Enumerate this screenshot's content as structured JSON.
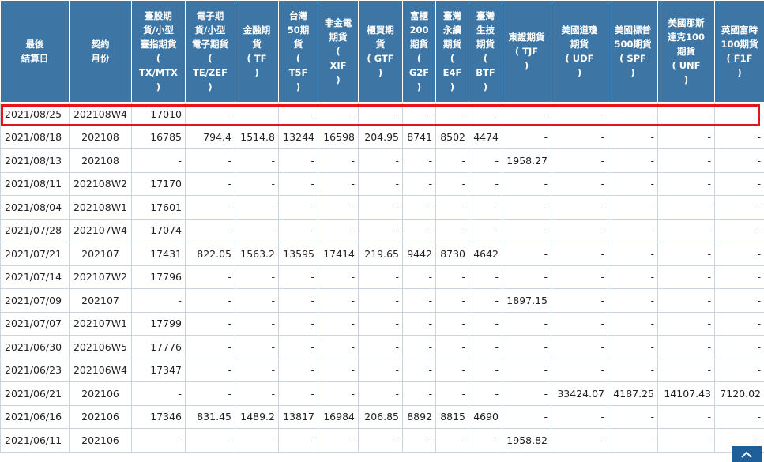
{
  "headers": [
    "最後\n結算日",
    "契約\n月份",
    "臺股期\n貨/小型\n臺指期貨\n(\nTX/MTX\n)",
    "電子期\n貨/小型\n電子期貨\n(\nTE/ZEF\n)",
    "金融期\n貨\n( TF\n)",
    "台灣\n50期\n貨\n(\nT5F\n)",
    "非金電\n期貨\n(\nXIF\n)",
    "櫃買期\n貨\n( GTF\n)",
    "富櫃\n200\n期貨\n(\nG2F\n)",
    "臺灣\n永續\n期貨\n(\nE4F\n)",
    "臺灣\n生技\n期貨\n(\nBTF\n)",
    "東證期貨\n( TJF\n)",
    "美國道瓊\n期貨\n( UDF\n)",
    "美國標普\n500期貨\n( SPF\n)",
    "美國那斯\n達克100\n期貨\n( UNF\n)",
    "英國富時\n100期貨\n( F1F\n)"
  ],
  "rows": [
    [
      "2021/08/25",
      "202108W4",
      "17010",
      "-",
      "-",
      "-",
      "-",
      "-",
      "-",
      "-",
      "-",
      "-",
      "-",
      "-",
      "-",
      "-"
    ],
    [
      "2021/08/18",
      "202108",
      "16785",
      "794.4",
      "1514.8",
      "13244",
      "16598",
      "204.95",
      "8741",
      "8502",
      "4474",
      "-",
      "-",
      "-",
      "-",
      "-"
    ],
    [
      "2021/08/13",
      "202108",
      "-",
      "-",
      "-",
      "-",
      "-",
      "-",
      "-",
      "-",
      "-",
      "1958.27",
      "-",
      "-",
      "-",
      "-"
    ],
    [
      "2021/08/11",
      "202108W2",
      "17170",
      "-",
      "-",
      "-",
      "-",
      "-",
      "-",
      "-",
      "-",
      "-",
      "-",
      "-",
      "-",
      "-"
    ],
    [
      "2021/08/04",
      "202108W1",
      "17601",
      "-",
      "-",
      "-",
      "-",
      "-",
      "-",
      "-",
      "-",
      "-",
      "-",
      "-",
      "-",
      "-"
    ],
    [
      "2021/07/28",
      "202107W4",
      "17074",
      "-",
      "-",
      "-",
      "-",
      "-",
      "-",
      "-",
      "-",
      "-",
      "-",
      "-",
      "-",
      "-"
    ],
    [
      "2021/07/21",
      "202107",
      "17431",
      "822.05",
      "1563.2",
      "13595",
      "17414",
      "219.65",
      "9442",
      "8730",
      "4642",
      "-",
      "-",
      "-",
      "-",
      "-"
    ],
    [
      "2021/07/14",
      "202107W2",
      "17796",
      "-",
      "-",
      "-",
      "-",
      "-",
      "-",
      "-",
      "-",
      "-",
      "-",
      "-",
      "-",
      "-"
    ],
    [
      "2021/07/09",
      "202107",
      "-",
      "-",
      "-",
      "-",
      "-",
      "-",
      "-",
      "-",
      "-",
      "1897.15",
      "-",
      "-",
      "-",
      "-"
    ],
    [
      "2021/07/07",
      "202107W1",
      "17799",
      "-",
      "-",
      "-",
      "-",
      "-",
      "-",
      "-",
      "-",
      "-",
      "-",
      "-",
      "-",
      "-"
    ],
    [
      "2021/06/30",
      "202106W5",
      "17776",
      "-",
      "-",
      "-",
      "-",
      "-",
      "-",
      "-",
      "-",
      "-",
      "-",
      "-",
      "-",
      "-"
    ],
    [
      "2021/06/23",
      "202106W4",
      "17347",
      "-",
      "-",
      "-",
      "-",
      "-",
      "-",
      "-",
      "-",
      "-",
      "-",
      "-",
      "-",
      "-"
    ],
    [
      "2021/06/21",
      "202106",
      "-",
      "-",
      "-",
      "-",
      "-",
      "-",
      "-",
      "-",
      "-",
      "-",
      "33424.07",
      "4187.25",
      "14107.43",
      "7120.02"
    ],
    [
      "2021/06/16",
      "202106",
      "17346",
      "831.45",
      "1489.2",
      "13817",
      "16984",
      "206.85",
      "8892",
      "8815",
      "4690",
      "-",
      "-",
      "-",
      "-",
      "-"
    ],
    [
      "2021/06/11",
      "202106",
      "-",
      "-",
      "-",
      "-",
      "-",
      "-",
      "-",
      "-",
      "-",
      "1958.82",
      "-",
      "-",
      "-",
      "-"
    ]
  ],
  "colors": {
    "header_bg": "#3d75a4",
    "highlight": "#e3151b",
    "border": "#c9d5e0"
  },
  "back_to_top_icon": "chevron-up-icon"
}
